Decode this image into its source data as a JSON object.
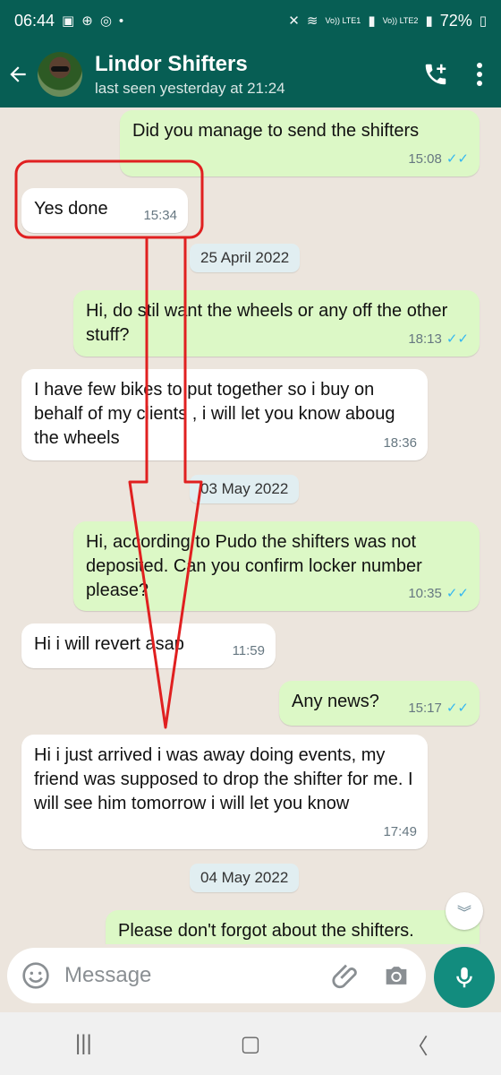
{
  "status_bar": {
    "time": "06:44",
    "battery": "72%",
    "lte1": "Vo)) LTE1",
    "lte2": "Vo)) LTE2"
  },
  "header": {
    "name": "Lindor Shifters",
    "last_seen": "last seen yesterday at 21:24"
  },
  "messages": [
    {
      "text": "Did you manage to send the shifters",
      "time": "15:08",
      "dir": "out"
    },
    {
      "text": "Yes done",
      "time": "15:34",
      "dir": "in"
    },
    {
      "date": "25 April 2022"
    },
    {
      "text": "Hi, do stil want the wheels or any off the other stuff?",
      "time": "18:13",
      "dir": "out"
    },
    {
      "text": "I have few bikes to put together so i buy on behalf of my clients , i will let you know aboug the wheels",
      "time": "18:36",
      "dir": "in"
    },
    {
      "date": "03 May 2022"
    },
    {
      "text": "Hi, according to Pudo the shifters was not deposited. Can you confirm locker number please?",
      "time": "10:35",
      "dir": "out"
    },
    {
      "text": "Hi i will revert asap",
      "time": "11:59",
      "dir": "in"
    },
    {
      "text": "Any news?",
      "time": "15:17",
      "dir": "out"
    },
    {
      "text": "Hi i just arrived i was away doing events, my friend was supposed to drop the shifter for me. I will see him tomorrow i will let you know",
      "time": "17:49",
      "dir": "in"
    },
    {
      "date": "04 May 2022"
    },
    {
      "text": "Please don't forgot about the shifters.",
      "dir": "out"
    }
  ],
  "input": {
    "placeholder": "Message"
  },
  "colors": {
    "header": "#075e54",
    "outgoing": "#dcf8c6",
    "incoming": "#ffffff",
    "accent": "#128c7e",
    "annotation": "#e02020"
  }
}
